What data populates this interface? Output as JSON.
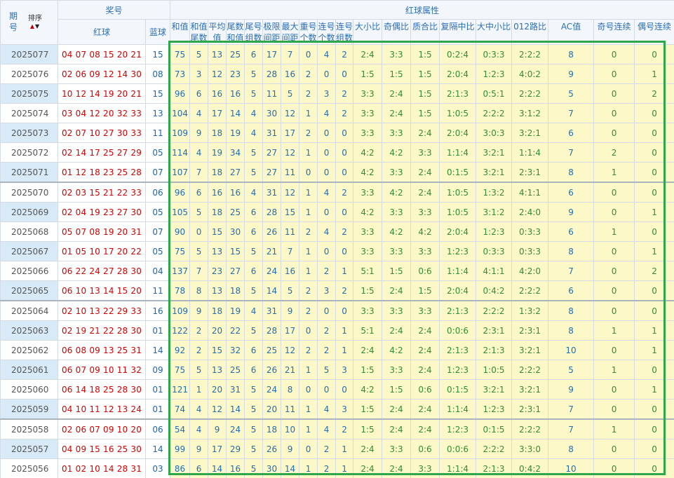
{
  "header": {
    "period_label": "期号",
    "sort_label": "排序",
    "draw_label": "奖号",
    "red_label": "红球",
    "blue_label": "蓝球",
    "attr_group_label": "红球属性",
    "columns": [
      "和值",
      "和值尾数",
      "平均值",
      "尾数和值",
      "尾号组数",
      "极限间距",
      "最大间距",
      "重号个数",
      "连号个数",
      "连号组数",
      "大小比",
      "奇偶比",
      "质合比",
      "复隔中比",
      "大中小比",
      "012路比",
      "AC值",
      "奇号连续",
      "偶号连续"
    ]
  },
  "colors": {
    "red_ball": "#d40000",
    "blue_ball": "#1e64b4",
    "highlight_border": "#2ea64a",
    "attr_bg": "#fdf8c8",
    "band_bg": "#d8eaf8"
  },
  "rows": [
    {
      "issue": "2025077",
      "red": "04 07 08 15 20 21",
      "blue": "15",
      "vals": [
        "75",
        "5",
        "13",
        "25",
        "6",
        "17",
        "7",
        "0",
        "4",
        "2",
        "2:4",
        "3:3",
        "1:5",
        "0:2:4",
        "0:3:3",
        "2:2:2",
        "8",
        "0",
        "0"
      ]
    },
    {
      "issue": "2025076",
      "red": "02 06 09 12 14 30",
      "blue": "08",
      "vals": [
        "73",
        "3",
        "12",
        "23",
        "5",
        "28",
        "16",
        "2",
        "0",
        "0",
        "1:5",
        "1:5",
        "1:5",
        "2:0:4",
        "1:2:3",
        "4:0:2",
        "9",
        "0",
        "1"
      ]
    },
    {
      "issue": "2025075",
      "red": "10 12 14 19 20 21",
      "blue": "15",
      "vals": [
        "96",
        "6",
        "16",
        "16",
        "5",
        "11",
        "5",
        "2",
        "3",
        "2",
        "3:3",
        "2:4",
        "1:5",
        "2:1:3",
        "0:5:1",
        "2:2:2",
        "5",
        "0",
        "2"
      ]
    },
    {
      "issue": "2025074",
      "red": "03 04 12 20 32 33",
      "blue": "13",
      "vals": [
        "104",
        "4",
        "17",
        "14",
        "4",
        "30",
        "12",
        "1",
        "4",
        "2",
        "3:3",
        "2:4",
        "1:5",
        "1:0:5",
        "2:2:2",
        "3:1:2",
        "7",
        "0",
        "0"
      ]
    },
    {
      "issue": "2025073",
      "red": "02 07 10 27 30 33",
      "blue": "11",
      "vals": [
        "109",
        "9",
        "18",
        "19",
        "4",
        "31",
        "17",
        "2",
        "0",
        "0",
        "3:3",
        "3:3",
        "2:4",
        "2:0:4",
        "3:0:3",
        "3:2:1",
        "6",
        "0",
        "0"
      ]
    },
    {
      "issue": "2025072",
      "red": "02 14 17 25 27 29",
      "blue": "05",
      "vals": [
        "114",
        "4",
        "19",
        "34",
        "5",
        "27",
        "12",
        "1",
        "0",
        "0",
        "4:2",
        "4:2",
        "3:3",
        "1:1:4",
        "3:2:1",
        "1:1:4",
        "7",
        "2",
        "0"
      ]
    },
    {
      "issue": "2025071",
      "red": "01 12 18 23 25 28",
      "blue": "07",
      "vals": [
        "107",
        "7",
        "18",
        "27",
        "5",
        "27",
        "11",
        "0",
        "0",
        "0",
        "4:2",
        "3:3",
        "2:4",
        "0:1:5",
        "3:2:1",
        "2:3:1",
        "8",
        "1",
        "0"
      ]
    },
    {
      "issue": "2025070",
      "red": "02 03 15 21 22 33",
      "blue": "06",
      "vals": [
        "96",
        "6",
        "16",
        "16",
        "4",
        "31",
        "12",
        "1",
        "4",
        "2",
        "3:3",
        "4:2",
        "2:4",
        "1:0:5",
        "1:3:2",
        "4:1:1",
        "6",
        "0",
        "0"
      ]
    },
    {
      "issue": "2025069",
      "red": "02 04 19 23 27 30",
      "blue": "05",
      "vals": [
        "105",
        "5",
        "18",
        "25",
        "6",
        "28",
        "15",
        "1",
        "0",
        "0",
        "4:2",
        "3:3",
        "3:3",
        "1:0:5",
        "3:1:2",
        "2:4:0",
        "9",
        "0",
        "1"
      ]
    },
    {
      "issue": "2025068",
      "red": "05 07 08 19 20 31",
      "blue": "07",
      "vals": [
        "90",
        "0",
        "15",
        "30",
        "6",
        "26",
        "11",
        "2",
        "4",
        "2",
        "3:3",
        "4:2",
        "4:2",
        "2:0:4",
        "1:2:3",
        "0:3:3",
        "6",
        "1",
        "0"
      ]
    },
    {
      "issue": "2025067",
      "red": "01 05 10 17 20 22",
      "blue": "05",
      "vals": [
        "75",
        "5",
        "13",
        "15",
        "5",
        "21",
        "7",
        "1",
        "0",
        "0",
        "3:3",
        "3:3",
        "3:3",
        "1:2:3",
        "0:3:3",
        "0:3:3",
        "8",
        "0",
        "1"
      ]
    },
    {
      "issue": "2025066",
      "red": "06 22 24 27 28 30",
      "blue": "04",
      "vals": [
        "137",
        "7",
        "23",
        "27",
        "6",
        "24",
        "16",
        "1",
        "2",
        "1",
        "5:1",
        "1:5",
        "0:6",
        "1:1:4",
        "4:1:1",
        "4:2:0",
        "7",
        "0",
        "2"
      ]
    },
    {
      "issue": "2025065",
      "red": "06 10 13 14 15 20",
      "blue": "11",
      "vals": [
        "78",
        "8",
        "13",
        "18",
        "5",
        "14",
        "5",
        "2",
        "3",
        "2",
        "1:5",
        "2:4",
        "1:5",
        "2:0:4",
        "0:4:2",
        "2:2:2",
        "6",
        "0",
        "0"
      ]
    },
    {
      "issue": "2025064",
      "red": "02 10 13 22 29 33",
      "blue": "16",
      "vals": [
        "109",
        "9",
        "18",
        "19",
        "4",
        "31",
        "9",
        "2",
        "0",
        "0",
        "3:3",
        "3:3",
        "3:3",
        "2:1:3",
        "2:2:2",
        "1:3:2",
        "8",
        "0",
        "0"
      ]
    },
    {
      "issue": "2025063",
      "red": "02 19 21 22 28 30",
      "blue": "01",
      "vals": [
        "122",
        "2",
        "20",
        "22",
        "5",
        "28",
        "17",
        "0",
        "2",
        "1",
        "5:1",
        "2:4",
        "2:4",
        "0:0:6",
        "2:3:1",
        "2:3:1",
        "8",
        "1",
        "1"
      ]
    },
    {
      "issue": "2025062",
      "red": "06 08 09 13 25 31",
      "blue": "14",
      "vals": [
        "92",
        "2",
        "15",
        "32",
        "6",
        "25",
        "12",
        "2",
        "2",
        "1",
        "2:4",
        "4:2",
        "2:4",
        "2:1:3",
        "2:1:3",
        "3:2:1",
        "10",
        "0",
        "1"
      ]
    },
    {
      "issue": "2025061",
      "red": "06 07 09 10 11 32",
      "blue": "09",
      "vals": [
        "75",
        "5",
        "13",
        "25",
        "6",
        "26",
        "21",
        "1",
        "5",
        "3",
        "1:5",
        "3:3",
        "2:4",
        "1:2:3",
        "1:0:5",
        "2:2:2",
        "5",
        "1",
        "0"
      ]
    },
    {
      "issue": "2025060",
      "red": "06 14 18 25 28 30",
      "blue": "01",
      "vals": [
        "121",
        "1",
        "20",
        "31",
        "5",
        "24",
        "8",
        "0",
        "0",
        "0",
        "4:2",
        "1:5",
        "0:6",
        "0:1:5",
        "3:2:1",
        "3:2:1",
        "9",
        "0",
        "1"
      ]
    },
    {
      "issue": "2025059",
      "red": "04 10 11 12 13 24",
      "blue": "01",
      "vals": [
        "74",
        "4",
        "12",
        "14",
        "5",
        "20",
        "11",
        "1",
        "4",
        "3",
        "1:5",
        "2:4",
        "2:4",
        "1:1:4",
        "1:2:3",
        "2:3:1",
        "7",
        "0",
        "0"
      ]
    },
    {
      "issue": "2025058",
      "red": "02 06 07 09 10 20",
      "blue": "06",
      "vals": [
        "54",
        "4",
        "9",
        "24",
        "5",
        "18",
        "10",
        "1",
        "4",
        "2",
        "1:5",
        "2:4",
        "2:4",
        "1:2:3",
        "0:1:5",
        "2:2:2",
        "7",
        "1",
        "0"
      ]
    },
    {
      "issue": "2025057",
      "red": "04 09 15 16 25 30",
      "blue": "14",
      "vals": [
        "99",
        "9",
        "17",
        "29",
        "5",
        "26",
        "9",
        "0",
        "2",
        "1",
        "2:4",
        "3:3",
        "0:6",
        "0:0:6",
        "2:2:2",
        "3:3:0",
        "8",
        "0",
        "0"
      ]
    },
    {
      "issue": "2025056",
      "red": "01 02 10 14 28 31",
      "blue": "03",
      "vals": [
        "86",
        "6",
        "14",
        "16",
        "5",
        "30",
        "14",
        "1",
        "2",
        "1",
        "2:4",
        "2:4",
        "3:3",
        "1:1:4",
        "2:1:3",
        "0:4:2",
        "10",
        "0",
        "0"
      ]
    }
  ]
}
